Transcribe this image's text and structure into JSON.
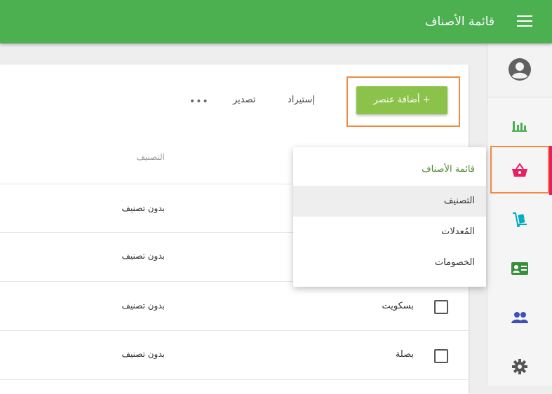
{
  "appbar": {
    "title": "قائمة الأصناف",
    "menu_icon": "hamburger-icon"
  },
  "sidebar": {
    "user_icon": "account-circle-icon",
    "items": [
      {
        "name": "reports",
        "icon": "bar-chart-icon",
        "color": "#4caf50"
      },
      {
        "name": "items",
        "icon": "shopping-basket-icon",
        "color": "#e91e63",
        "active": true
      },
      {
        "name": "inventory",
        "icon": "hand-truck-icon",
        "color": "#00acc1"
      },
      {
        "name": "customers",
        "icon": "contact-card-icon",
        "color": "#388e3c"
      },
      {
        "name": "employees",
        "icon": "people-icon",
        "color": "#3f51b5"
      },
      {
        "name": "settings",
        "icon": "gear-icon",
        "color": "#555555"
      }
    ]
  },
  "toolbar": {
    "add_label": "+ أضافة عنصر",
    "import_label": "إستيراد",
    "export_label": "تصدير",
    "more_label": "•••"
  },
  "table": {
    "category_header": "التصنيف",
    "rows": [
      {
        "name": "",
        "category": "بدون تصنيف"
      },
      {
        "name": "",
        "category": "بدون تصنيف"
      },
      {
        "name": "بسكويت",
        "category": "بدون تصنيف"
      },
      {
        "name": "بصلة",
        "category": "بدون تصنيف"
      }
    ]
  },
  "menu": {
    "items": [
      {
        "label": "قائمة الأصناف"
      },
      {
        "label": "التصنيف"
      },
      {
        "label": "المُعدلات"
      },
      {
        "label": "الخصومات"
      }
    ]
  },
  "colors": {
    "appbar": "#4caf50",
    "add_button": "#8bc34a",
    "highlight": "#f08a3c",
    "active_indicator": "#e91e63"
  }
}
